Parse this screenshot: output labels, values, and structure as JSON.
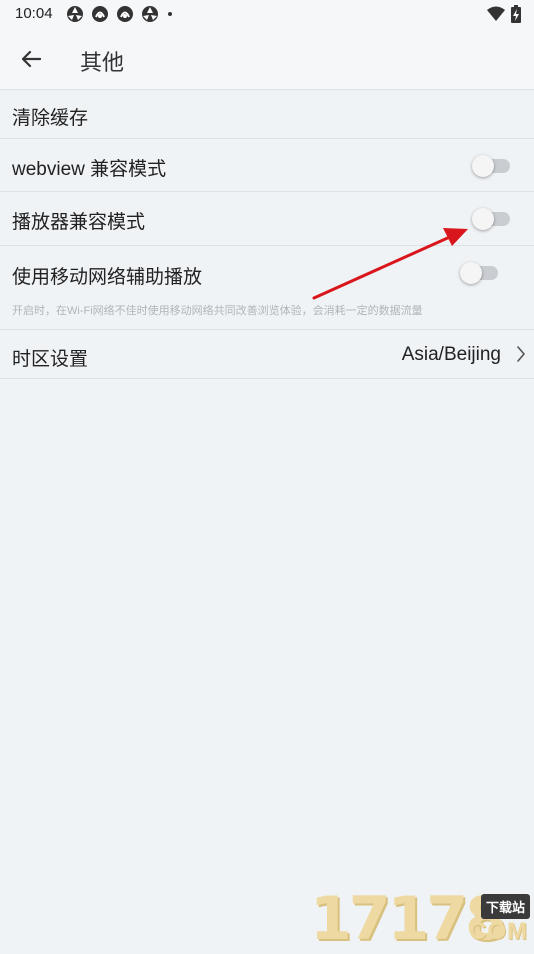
{
  "status_bar": {
    "time": "10:04",
    "notification_icons": [
      "app-icon-1",
      "app-icon-2",
      "app-icon-3",
      "app-icon-4",
      "more-dot-icon"
    ],
    "right_icons": [
      "wifi-icon",
      "battery-charging-icon"
    ]
  },
  "header": {
    "back_icon": "arrow-left-icon",
    "title": "其他"
  },
  "settings": {
    "clear_cache": {
      "label": "清除缓存"
    },
    "webview_compat": {
      "label": "webview 兼容模式",
      "enabled": false
    },
    "player_compat": {
      "label": "播放器兼容模式",
      "enabled": false
    },
    "mobile_assist": {
      "label": "使用移动网络辅助播放",
      "description": "开启时，在Wi-Fi网络不佳时使用移动网络共同改善浏览体验，会消耗一定的数据流量",
      "enabled": false
    },
    "timezone": {
      "label": "时区设置",
      "value": "Asia/Beijing"
    }
  },
  "annotation": {
    "color": "#d9161c"
  },
  "watermark": {
    "digits": "17178",
    "tag": "下载站",
    "suffix": "COM"
  },
  "colors": {
    "background": "#f0f3f6",
    "divider": "#dde1e6",
    "toggle_off_track": "#c9ccd0",
    "toggle_off_knob": "#f5f5f5"
  }
}
